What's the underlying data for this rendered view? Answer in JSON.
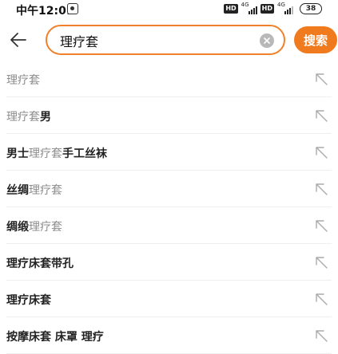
{
  "status_bar": {
    "time": "中午12:01",
    "hd1": "HD",
    "net1": "4G",
    "hd2": "HD",
    "net2": "4G",
    "battery": "38"
  },
  "search": {
    "query": "理疗套",
    "placeholder": "",
    "submit_label": "搜索",
    "accent_color": "#f07a1e"
  },
  "suggestions": [
    {
      "segments": [
        {
          "text": "理疗套",
          "match": true
        }
      ]
    },
    {
      "segments": [
        {
          "text": "理疗套",
          "match": true
        },
        {
          "text": "男",
          "match": false
        }
      ]
    },
    {
      "segments": [
        {
          "text": "男士",
          "match": false
        },
        {
          "text": "理疗套",
          "match": true
        },
        {
          "text": "手工丝袜",
          "match": false
        }
      ]
    },
    {
      "segments": [
        {
          "text": "丝绸",
          "match": false
        },
        {
          "text": "理疗套",
          "match": true
        }
      ]
    },
    {
      "segments": [
        {
          "text": "绸缎",
          "match": false
        },
        {
          "text": "理疗套",
          "match": true
        }
      ]
    },
    {
      "segments": [
        {
          "text": "理疗床套带孔",
          "match": false
        }
      ]
    },
    {
      "segments": [
        {
          "text": "理疗床套",
          "match": false
        }
      ]
    },
    {
      "segments": [
        {
          "text": "按摩床套 床罩 理疗",
          "match": false
        }
      ]
    }
  ],
  "icons": {
    "back": "arrow-left-icon",
    "clear": "clear-icon",
    "fill": "arrow-up-left-icon"
  }
}
